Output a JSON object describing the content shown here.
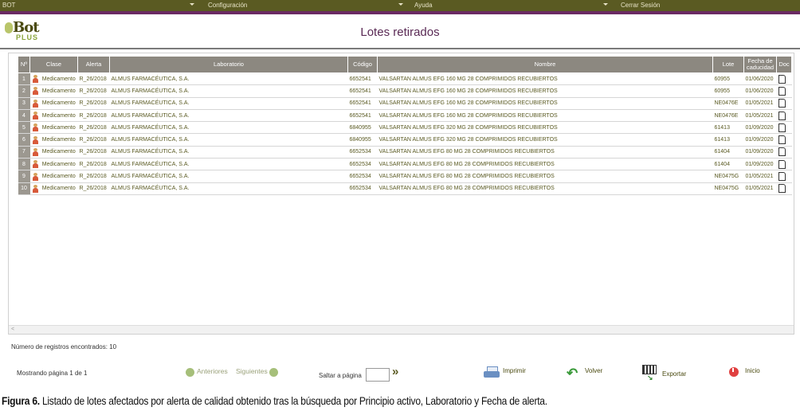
{
  "topnav": {
    "items": [
      "BOT",
      "Configuración",
      "Ayuda",
      "Cerrar Sesión"
    ]
  },
  "header": {
    "logo_top": "Bot",
    "logo_bottom": "PLUS",
    "title": "Lotes retirados"
  },
  "table": {
    "columns": [
      "Nº",
      "Clase",
      "Alerta",
      "Laboratorio",
      "Código",
      "Nombre",
      "Lote",
      "Fecha de caducidad",
      "Doc"
    ],
    "rows": [
      {
        "n": "1",
        "clase": "Medicamento",
        "alerta": "R_26/2018",
        "laboratorio": "ALMUS FARMACÉUTICA, S.A.",
        "codigo": "6652541",
        "nombre": "VALSARTAN ALMUS EFG 160 MG 28 COMPRIMIDOS RECUBIERTOS",
        "lote": "60955",
        "fecha": "01/06/2020"
      },
      {
        "n": "2",
        "clase": "Medicamento",
        "alerta": "R_26/2018",
        "laboratorio": "ALMUS FARMACÉUTICA, S.A.",
        "codigo": "6652541",
        "nombre": "VALSARTAN ALMUS EFG 160 MG 28 COMPRIMIDOS RECUBIERTOS",
        "lote": "60955",
        "fecha": "01/06/2020"
      },
      {
        "n": "3",
        "clase": "Medicamento",
        "alerta": "R_26/2018",
        "laboratorio": "ALMUS FARMACÉUTICA, S.A.",
        "codigo": "6652541",
        "nombre": "VALSARTAN ALMUS EFG 160 MG 28 COMPRIMIDOS RECUBIERTOS",
        "lote": "NE0476E",
        "fecha": "01/05/2021"
      },
      {
        "n": "4",
        "clase": "Medicamento",
        "alerta": "R_26/2018",
        "laboratorio": "ALMUS FARMACÉUTICA, S.A.",
        "codigo": "6652541",
        "nombre": "VALSARTAN ALMUS EFG 160 MG 28 COMPRIMIDOS RECUBIERTOS",
        "lote": "NE0476E",
        "fecha": "01/05/2021"
      },
      {
        "n": "5",
        "clase": "Medicamento",
        "alerta": "R_26/2018",
        "laboratorio": "ALMUS FARMACÉUTICA, S.A.",
        "codigo": "6840955",
        "nombre": "VALSARTAN ALMUS EFG 320 MG 28 COMPRIMIDOS RECUBIERTOS",
        "lote": "61413",
        "fecha": "01/09/2020"
      },
      {
        "n": "6",
        "clase": "Medicamento",
        "alerta": "R_26/2018",
        "laboratorio": "ALMUS FARMACÉUTICA, S.A.",
        "codigo": "6840955",
        "nombre": "VALSARTAN ALMUS EFG 320 MG 28 COMPRIMIDOS RECUBIERTOS",
        "lote": "61413",
        "fecha": "01/09/2020"
      },
      {
        "n": "7",
        "clase": "Medicamento",
        "alerta": "R_26/2018",
        "laboratorio": "ALMUS FARMACÉUTICA, S.A.",
        "codigo": "6652534",
        "nombre": "VALSARTAN ALMUS EFG 80 MG 28 COMPRIMIDOS RECUBIERTOS",
        "lote": "61404",
        "fecha": "01/09/2020"
      },
      {
        "n": "8",
        "clase": "Medicamento",
        "alerta": "R_26/2018",
        "laboratorio": "ALMUS FARMACÉUTICA, S.A.",
        "codigo": "6652534",
        "nombre": "VALSARTAN ALMUS EFG 80 MG 28 COMPRIMIDOS RECUBIERTOS",
        "lote": "61404",
        "fecha": "01/09/2020"
      },
      {
        "n": "9",
        "clase": "Medicamento",
        "alerta": "R_26/2018",
        "laboratorio": "ALMUS FARMACÉUTICA, S.A.",
        "codigo": "6652534",
        "nombre": "VALSARTAN ALMUS EFG 80 MG 28 COMPRIMIDOS RECUBIERTOS",
        "lote": "NE0475G",
        "fecha": "01/05/2021"
      },
      {
        "n": "10",
        "clase": "Medicamento",
        "alerta": "R_26/2018",
        "laboratorio": "ALMUS FARMACÉUTICA, S.A.",
        "codigo": "6652534",
        "nombre": "VALSARTAN ALMUS EFG 80 MG 28 COMPRIMIDOS RECUBIERTOS",
        "lote": "NE0475G",
        "fecha": "01/05/2021"
      }
    ]
  },
  "footer": {
    "records": "Número de registros encontrados: 10",
    "page_info": "Mostrando página 1 de 1",
    "prev": "Anteriores",
    "next": "Siguientes",
    "jump": "Saltar a página",
    "print": "Imprimir",
    "back": "Volver",
    "export": "Exportar",
    "exit": "Inicio"
  },
  "caption": {
    "label": "Figura 6.",
    "text": " Listado de lotes afectados por alerta de calidad obtenido tras la búsqueda por Principio activo, Laboratorio y Fecha de alerta."
  },
  "icons": {
    "row_class_icon": "person-icon",
    "doc_icon": "document-icon"
  },
  "colors": {
    "topnav": "#5a5a22",
    "accent": "#6a2a62",
    "table_header": "#8c8880",
    "text": "#5a5a22"
  }
}
